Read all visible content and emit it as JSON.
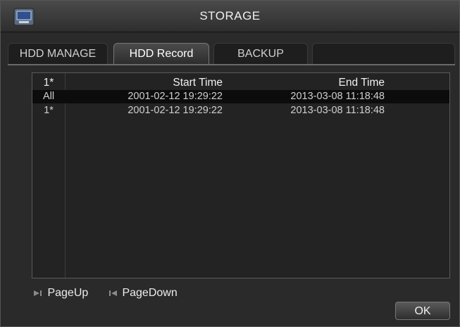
{
  "window": {
    "title": "STORAGE"
  },
  "tabs": [
    {
      "label": "HDD MANAGE",
      "active": false
    },
    {
      "label": "HDD Record",
      "active": true
    },
    {
      "label": "BACKUP",
      "active": false
    }
  ],
  "table": {
    "headers": {
      "disk": "1*",
      "start": "Start Time",
      "end": "End Time"
    },
    "rows": [
      {
        "disk": "All",
        "start": "2001-02-12 19:29:22",
        "end": "2013-03-08 11:18:48",
        "selected": true
      },
      {
        "disk": "1*",
        "start": "2001-02-12 19:29:22",
        "end": "2013-03-08 11:18:48",
        "selected": false
      }
    ]
  },
  "pager": {
    "up_label": "PageUp",
    "down_label": "PageDown"
  },
  "buttons": {
    "ok_label": "OK"
  },
  "colors": {
    "background": "#2a2a2a",
    "selected_row": "#0c0c0c",
    "text": "#e6e6e6"
  }
}
